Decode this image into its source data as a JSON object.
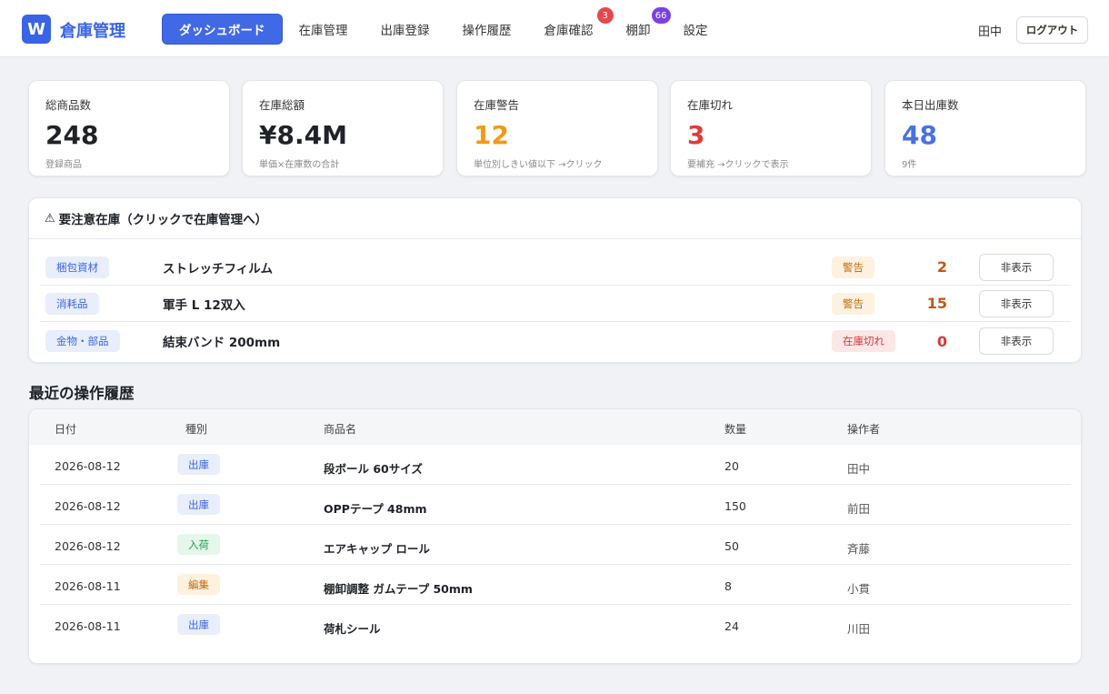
{
  "header": {
    "logo_letter": "W",
    "app_title": "倉庫管理",
    "nav": [
      {
        "label": "ダッシュボード",
        "active": true
      },
      {
        "label": "在庫管理"
      },
      {
        "label": "出庫登録"
      },
      {
        "label": "操作履歴"
      },
      {
        "label": "倉庫確認",
        "badge": "3"
      },
      {
        "label": "棚卸",
        "badge": "66"
      },
      {
        "label": "設定"
      }
    ],
    "user": "田中",
    "logout": "ログアウト"
  },
  "stats": [
    {
      "label": "総商品数",
      "value": "248",
      "sub": "登録商品"
    },
    {
      "label": "在庫総額",
      "value": "¥8.4M",
      "sub": "単価×在庫数の合計"
    },
    {
      "label": "在庫警告",
      "value": "12",
      "sub": "単位別しきい値以下 →クリック"
    },
    {
      "label": "在庫切れ",
      "value": "3",
      "sub": "要補充 →クリックで表示"
    },
    {
      "label": "本日出庫数",
      "value": "48",
      "sub": "9件"
    }
  ],
  "alerts": {
    "icon": "⚠",
    "title": "要注意在庫（クリックで在庫管理へ）",
    "hide_label": "非表示",
    "rows": [
      {
        "category": "梱包資材",
        "name": "ストレッチフィルム",
        "status": "警告",
        "qty": "2"
      },
      {
        "category": "消耗品",
        "name": "軍手 L 12双入",
        "status": "警告",
        "qty": "15"
      },
      {
        "category": "金物・部品",
        "name": "結束バンド 200mm",
        "status": "在庫切れ",
        "qty": "0"
      }
    ]
  },
  "history": {
    "title": "最近の操作履歴",
    "columns": [
      "日付",
      "種別",
      "商品名",
      "数量",
      "操作者"
    ],
    "rows": [
      {
        "date": "2026-08-12",
        "type": "出庫",
        "name": "段ボール 60サイズ",
        "qty": "20",
        "operator": "田中"
      },
      {
        "date": "2026-08-12",
        "type": "出庫",
        "name": "OPPテープ 48mm",
        "qty": "150",
        "operator": "前田"
      },
      {
        "date": "2026-08-12",
        "type": "入荷",
        "name": "エアキャップ ロール",
        "qty": "50",
        "operator": "斉藤"
      },
      {
        "date": "2026-08-11",
        "type": "編集",
        "name": "棚卸調整 ガムテープ 50mm",
        "qty": "8",
        "operator": "小貫"
      },
      {
        "date": "2026-08-11",
        "type": "出庫",
        "name": "荷札シール",
        "qty": "24",
        "operator": "川田"
      }
    ]
  },
  "colors": {
    "accent": "#3a64e6",
    "warning": "#f09a1a",
    "danger": "#e03c3c",
    "info": "#4a72e0"
  }
}
